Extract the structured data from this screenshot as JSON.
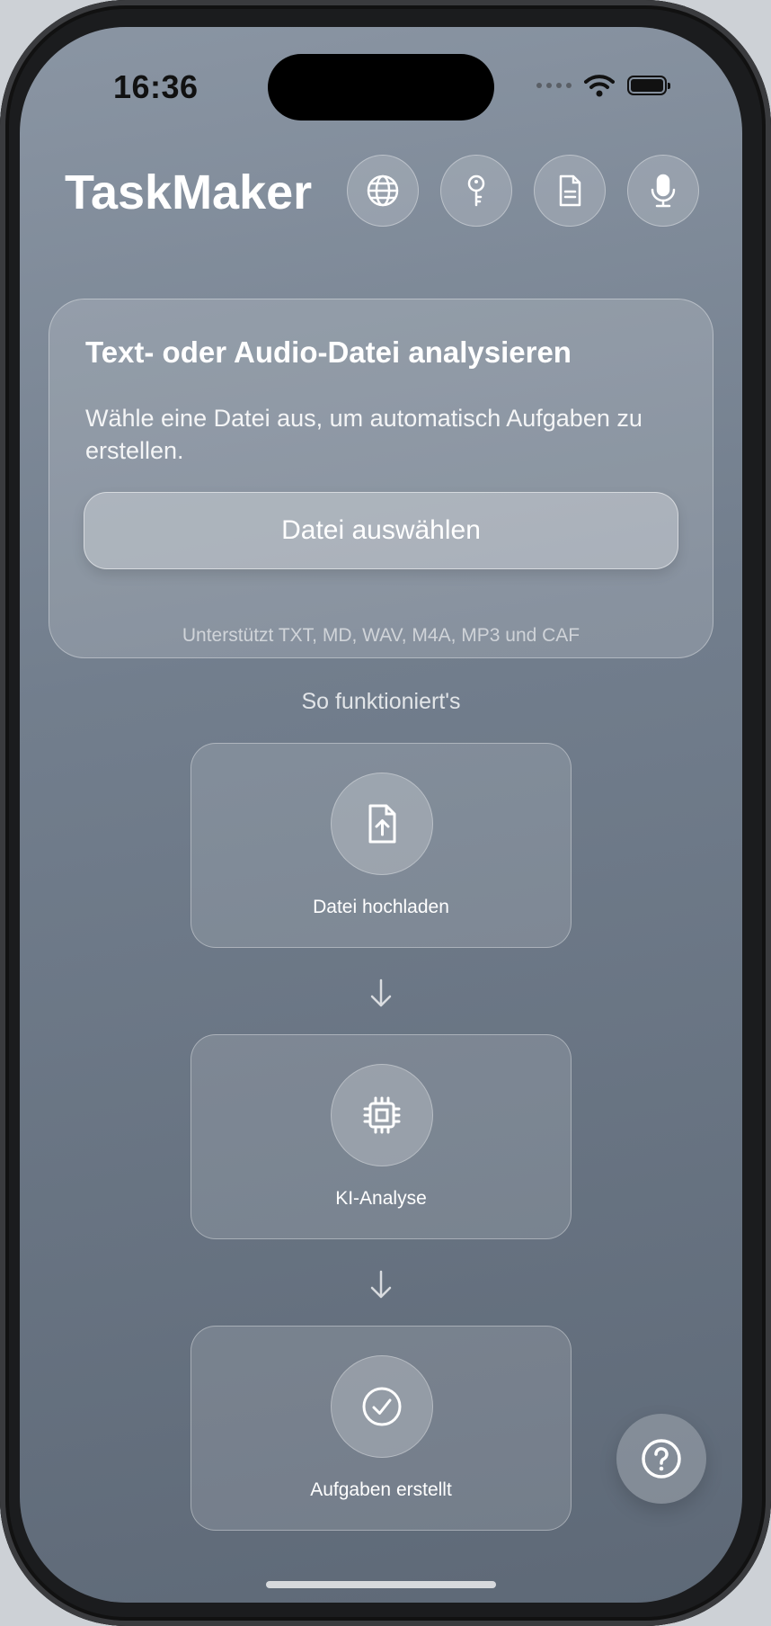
{
  "status_bar": {
    "time": "16:36"
  },
  "header": {
    "title": "TaskMaker",
    "buttons": [
      "globe-icon",
      "key-icon",
      "document-icon",
      "microphone-icon"
    ]
  },
  "upload_card": {
    "title": "Text- oder Audio-Datei analysieren",
    "description": "Wähle eine Datei aus, um automatisch Aufgaben zu erstellen.",
    "button_label": "Datei auswählen",
    "supported_formats": "Unterstützt TXT, MD, WAV, M4A, MP3 und CAF"
  },
  "how_it_works": {
    "title": "So funktioniert's",
    "steps": [
      {
        "label": "Datei hochladen",
        "icon": "file-upload-icon"
      },
      {
        "label": "KI-Analyse",
        "icon": "cpu-icon"
      },
      {
        "label": "Aufgaben erstellt",
        "icon": "checkmark-circle-icon"
      }
    ]
  },
  "help": {
    "icon": "question-icon"
  }
}
